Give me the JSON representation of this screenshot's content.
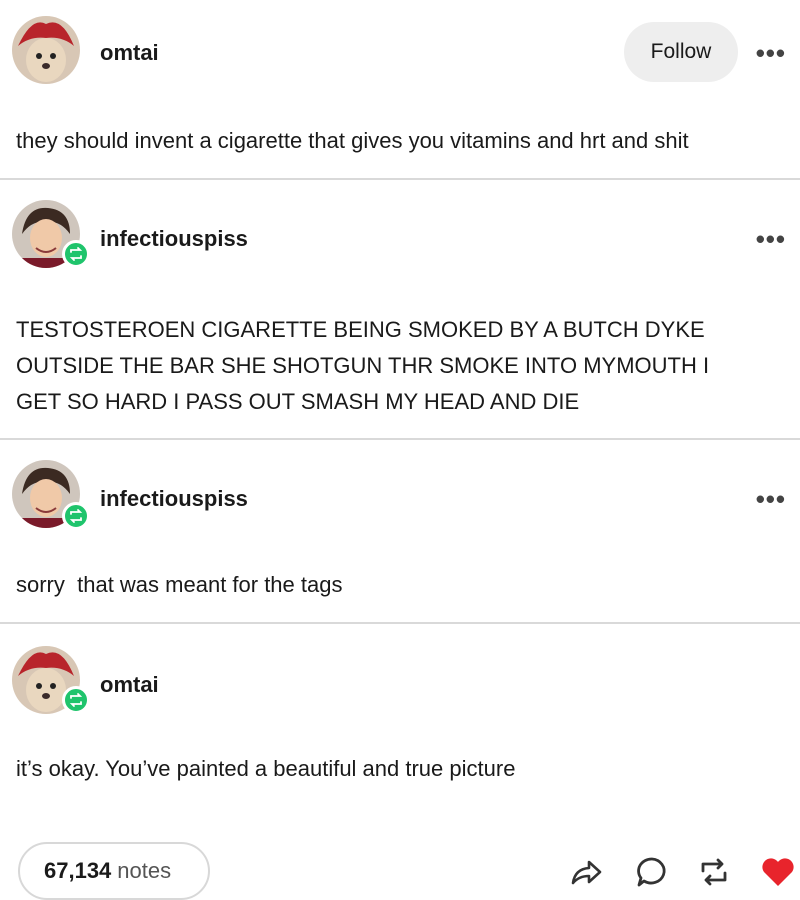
{
  "posts": [
    {
      "username": "omtai",
      "avatar": "dog-avatar-icon",
      "reblog": false,
      "follow_label": "Follow",
      "more": "•••",
      "body": "they should invent a cigarette that gives you vitamins and hrt and shit"
    },
    {
      "username": "infectiouspiss",
      "avatar": "person-avatar-icon",
      "reblog": true,
      "more": "•••",
      "body_lines": [
        "TESTOSTEROEN CIGARETTE BEING SMOKED BY A BUTCH DYKE",
        "OUTSIDE THE BAR SHE SHOTGUN THR SMOKE INTO MYMOUTH I",
        "GET SO HARD I PASS OUT SMASH MY HEAD AND DIE"
      ]
    },
    {
      "username": "infectiouspiss",
      "avatar": "person-avatar-icon",
      "reblog": true,
      "more": "•••",
      "body": "sorry  that was meant for the tags"
    },
    {
      "username": "omtai",
      "avatar": "dog-avatar-icon",
      "reblog": true,
      "body": "it’s okay. You’ve painted a beautiful and true picture"
    }
  ],
  "footer": {
    "notes_count": "67,134",
    "notes_label": "notes",
    "icons": [
      "share-icon",
      "comment-icon",
      "reblog-icon",
      "like-heart-icon"
    ],
    "like_color": "#e8242c",
    "reblog_badge_color": "#1fc46c"
  }
}
